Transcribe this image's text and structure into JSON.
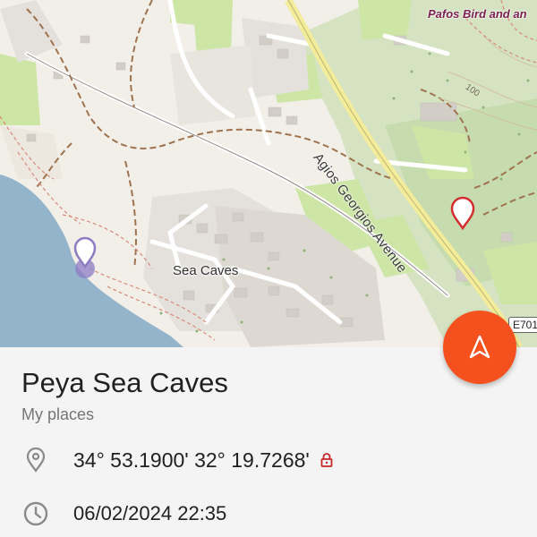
{
  "map": {
    "road_label": "Agios Georgios Avenue",
    "poi_label": "Pafos Bird and an",
    "place_label": "Sea Caves",
    "contour_label": "100",
    "route_shield": "E701"
  },
  "fab": {
    "icon": "navigation-arrow-icon",
    "color": "#f4511e"
  },
  "place": {
    "title": "Peya Sea Caves",
    "category": "My places",
    "coordinates": "34° 53.1900' 32° 19.7268'",
    "date": "06/02/2024 22:35"
  },
  "icons": {
    "location": "location-pin-icon",
    "lock": "lock-icon",
    "clock": "clock-icon"
  },
  "colors": {
    "accent": "#f4511e",
    "marker_red": "#d32f2f",
    "marker_purple": "#8e7cc3",
    "lock_red": "#c62828",
    "sea": "#8fb0c7",
    "green": "#cfe5a7",
    "forest": "#b7d49a"
  }
}
